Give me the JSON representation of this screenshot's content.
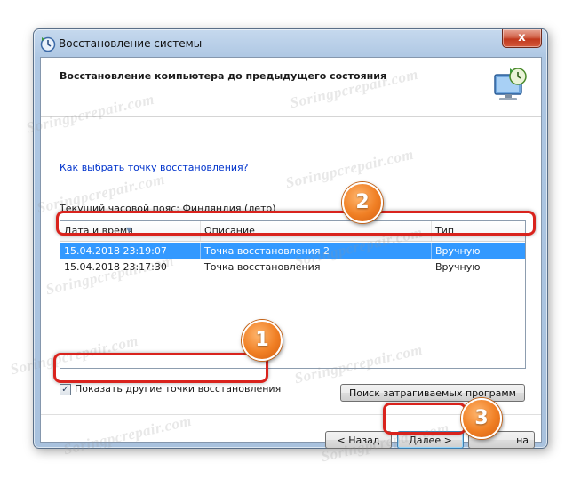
{
  "window": {
    "title": "Восстановление системы",
    "close_glyph": "x",
    "header_title": "Восстановление компьютера до предыдущего состояния"
  },
  "content": {
    "help_link": "Как выбрать точку восстановления?",
    "timezone_label": "Текущий часовой пояс: Финляндия (лето)"
  },
  "table": {
    "columns": [
      "Дата и время",
      "Описание",
      "Тип"
    ],
    "sort_column": "Дата и время",
    "rows": [
      {
        "date": "15.04.2018 23:19:07",
        "description": "Точка восстановления 2",
        "type": "Вручную",
        "selected": true
      },
      {
        "date": "15.04.2018 23:17:30",
        "description": "Точка восстановления",
        "type": "Вручную",
        "selected": false
      }
    ]
  },
  "controls": {
    "show_more_label": "Показать другие точки восстановления",
    "show_more_checked": true,
    "scan_button": "Поиск затрагиваемых программ",
    "back_button": "< Назад",
    "next_button": "Далее >",
    "cancel_button_visible": "на"
  },
  "annotations": {
    "badge_1": "1",
    "badge_2": "2",
    "badge_3": "3",
    "highlight_color": "#d9231d",
    "badge_color": "#f07f24"
  },
  "watermark": "Soringpcrepair.com",
  "colors": {
    "selection": "#3399ff",
    "link": "#0033cc",
    "frame": "#aec7e3"
  }
}
